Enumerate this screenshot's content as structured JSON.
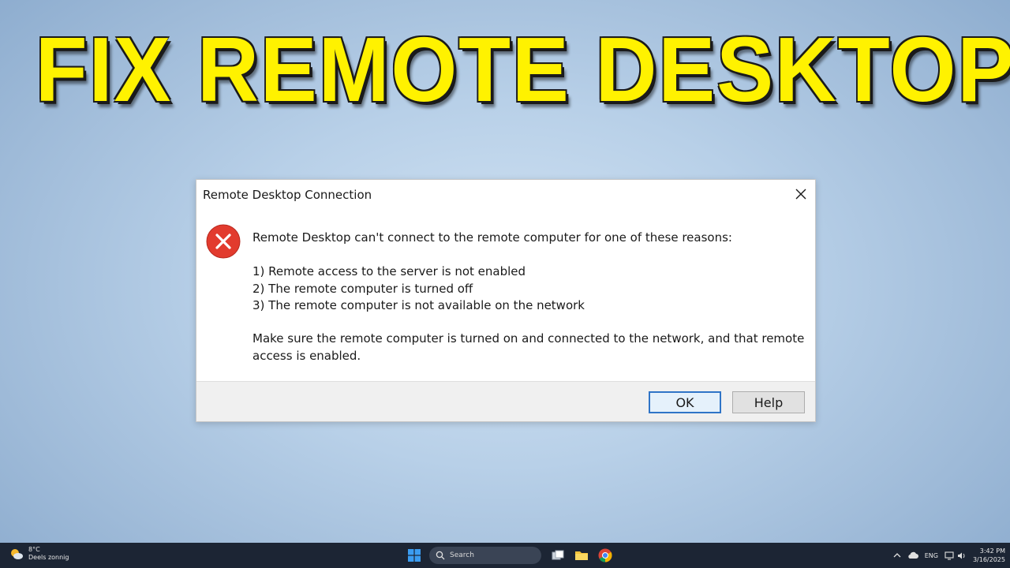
{
  "overlay": {
    "headline": "FIX REMOTE DESKTOP"
  },
  "dialog": {
    "title": "Remote Desktop Connection",
    "message": "Remote Desktop can't connect to the remote computer for one of these reasons:",
    "reasons": [
      "1) Remote access to the server is not enabled",
      "2) The remote computer is turned off",
      "3) The remote computer is not available on the network"
    ],
    "advice": "Make sure the remote computer is turned on and connected to the network, and that remote access is enabled.",
    "icon": "error-icon",
    "buttons": {
      "ok": "OK",
      "help": "Help"
    }
  },
  "taskbar": {
    "weather": {
      "temp": "8°C",
      "condition": "Deels zonnig",
      "icon": "partly-sunny-icon"
    },
    "search_label": "Search",
    "apps": [
      "start-icon",
      "search-icon",
      "task-view-icon",
      "file-explorer-icon",
      "chrome-icon"
    ],
    "tray": {
      "language": "ENG",
      "time": "3:42 PM",
      "date": "3/16/2025"
    }
  },
  "colors": {
    "headline": "#fff200",
    "error_red": "#e23b2e",
    "taskbar": "#1c2534",
    "ok_border": "#2f74c7"
  }
}
